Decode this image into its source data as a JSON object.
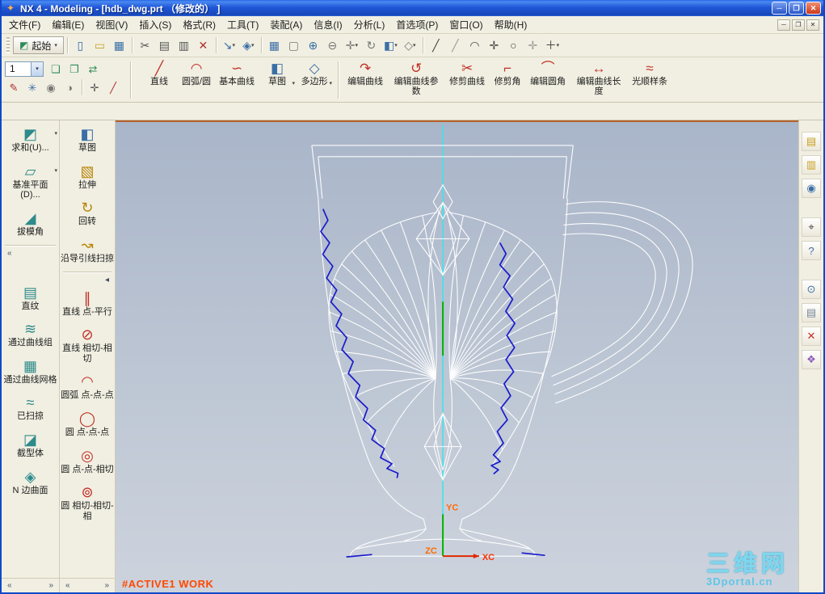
{
  "window": {
    "title": "NX 4 - Modeling - [hdb_dwg.prt （修改的） ]",
    "app_icon_glyph": "✦",
    "controls": {
      "minimize": "─",
      "maximize": "❐",
      "close": "✕"
    }
  },
  "menu": {
    "items": [
      "文件(F)",
      "编辑(E)",
      "视图(V)",
      "插入(S)",
      "格式(R)",
      "工具(T)",
      "装配(A)",
      "信息(I)",
      "分析(L)",
      "首选项(P)",
      "窗口(O)",
      "帮助(H)"
    ],
    "mdi_controls": [
      "─",
      "❐",
      "✕"
    ]
  },
  "toolbar_main": {
    "start_label": "起始",
    "start_icon_glyph": "◩",
    "icons": [
      {
        "name": "new-file-icon",
        "glyph": "▯",
        "color": "#3a6ea5"
      },
      {
        "name": "open-file-icon",
        "glyph": "▭",
        "color": "#c8a020"
      },
      {
        "name": "save-icon",
        "glyph": "▦",
        "color": "#3a6ea5"
      },
      {
        "sep": true
      },
      {
        "name": "cut-icon",
        "glyph": "✂",
        "color": "#555555"
      },
      {
        "name": "copy-icon",
        "glyph": "▤",
        "color": "#555555"
      },
      {
        "name": "paste-icon",
        "glyph": "▥",
        "color": "#555555"
      },
      {
        "name": "delete-icon",
        "glyph": "✕",
        "color": "#b03030"
      },
      {
        "sep": true
      },
      {
        "name": "transform-icon",
        "glyph": "↘",
        "color": "#3a6ea5",
        "arrow": true
      },
      {
        "name": "orient-view-icon",
        "glyph": "◈",
        "color": "#3a6ea5",
        "arrow": true
      },
      {
        "sep": true
      },
      {
        "name": "grid-icon",
        "glyph": "▦",
        "color": "#3a6ea5"
      },
      {
        "name": "fit-view-icon",
        "glyph": "▢",
        "color": "#777777"
      },
      {
        "name": "zoom-in-icon",
        "glyph": "⊕",
        "color": "#3a6ea5"
      },
      {
        "name": "zoom-out-icon",
        "glyph": "⊖",
        "color": "#777777"
      },
      {
        "name": "pan-icon",
        "glyph": "✛",
        "color": "#777777",
        "arrow": true
      },
      {
        "name": "rotate-view-icon",
        "glyph": "↻",
        "color": "#777777"
      },
      {
        "name": "shaded-display-icon",
        "glyph": "◧",
        "color": "#3a6ea5",
        "arrow": true
      },
      {
        "name": "wireframe-display-icon",
        "glyph": "◇",
        "color": "#777777",
        "arrow": true
      },
      {
        "sep": true
      },
      {
        "name": "line-snap-icon",
        "glyph": "╱",
        "color": "#444444"
      },
      {
        "name": "angled-line-snap-icon",
        "glyph": "╱",
        "color": "#999999"
      },
      {
        "name": "arc-snap-icon",
        "glyph": "◠",
        "color": "#444444"
      },
      {
        "name": "cross-snap-icon",
        "glyph": "✛",
        "color": "#444444"
      },
      {
        "name": "circle-snap-icon",
        "glyph": "○",
        "color": "#444444"
      },
      {
        "name": "point-snap-icon",
        "glyph": "✛",
        "color": "#999999"
      },
      {
        "name": "more-snap-icon",
        "glyph": "＋",
        "color": "#444444",
        "arrow": true
      }
    ]
  },
  "toolbar_curve": {
    "layer_value": "1",
    "row1_icons": [
      {
        "name": "layer-settings-icon",
        "glyph": "❏",
        "color": "#2e8b57"
      },
      {
        "name": "layer-visible-icon",
        "glyph": "❐",
        "color": "#2e8b57"
      },
      {
        "name": "move-to-layer-icon",
        "glyph": "⇄",
        "color": "#2e8b57"
      }
    ],
    "row2_icons": [
      {
        "name": "snap-endpoint-icon",
        "glyph": "✎",
        "color": "#b03030"
      },
      {
        "name": "snap-intersection-icon",
        "glyph": "✳",
        "color": "#3a6ea5"
      },
      {
        "name": "snap-center-icon",
        "glyph": "◉",
        "color": "#777777"
      },
      {
        "name": "snap-quadrant-icon",
        "glyph": "◑",
        "color": "#777777"
      },
      {
        "sep": true
      },
      {
        "name": "snap-existing-point-icon",
        "glyph": "✛",
        "color": "#555555"
      },
      {
        "name": "snap-midpoint-icon",
        "glyph": "╱",
        "color": "#b03030"
      }
    ],
    "groups": [
      {
        "buttons": [
          {
            "name": "line-button",
            "label": "直线",
            "glyph": "╱",
            "color": "#c03028"
          },
          {
            "name": "arc-circle-button",
            "label": "圆弧/圆",
            "glyph": "◠",
            "color": "#c03028"
          },
          {
            "name": "basic-curve-button",
            "label": "基本曲线",
            "glyph": "∽",
            "color": "#c03028"
          },
          {
            "name": "sketch-button",
            "label": "草图",
            "glyph": "◧",
            "color": "#3a6ea5",
            "arrow": true
          },
          {
            "name": "polygon-button",
            "label": "多边形",
            "glyph": "◇",
            "color": "#3a6ea5",
            "arrow": true
          }
        ]
      },
      {
        "buttons": [
          {
            "name": "edit-curve-button",
            "label": "编辑曲线",
            "glyph": "↷",
            "color": "#c03028"
          },
          {
            "name": "edit-curve-params-button",
            "label": "编辑曲线参数",
            "glyph": "↺",
            "color": "#c03028"
          },
          {
            "name": "trim-curve-button",
            "label": "修剪曲线",
            "glyph": "✂",
            "color": "#c03028"
          },
          {
            "name": "trim-corner-button",
            "label": "修剪角",
            "glyph": "⌐",
            "color": "#c03028"
          },
          {
            "name": "edit-fillet-button",
            "label": "编辑圆角",
            "glyph": "⌒",
            "color": "#c03028"
          },
          {
            "name": "edit-curve-length-button",
            "label": "编辑曲线长度",
            "glyph": "↔",
            "color": "#c03028"
          },
          {
            "name": "smooth-spline-button",
            "label": "光顺样条",
            "glyph": "≈",
            "color": "#c03028"
          }
        ]
      }
    ]
  },
  "left_panel": {
    "col1_groups": [
      [
        {
          "name": "boolean-sum-button",
          "label": "求和(U)...",
          "glyph": "◩",
          "color": "#2e8b8b",
          "arrow": true
        },
        {
          "name": "datum-plane-button",
          "label": "基准平面(D)...",
          "glyph": "▱",
          "color": "#2e8b8b",
          "arrow": true
        },
        {
          "name": "draft-angle-button",
          "label": "拔模角",
          "glyph": "◢",
          "color": "#2e8b8b"
        }
      ],
      [
        {
          "name": "ruled-surface-button",
          "label": "直纹",
          "glyph": "▤",
          "color": "#2e8b8b"
        },
        {
          "name": "through-curves-button",
          "label": "通过曲线组",
          "glyph": "≋",
          "color": "#2e8b8b"
        },
        {
          "name": "through-curve-mesh-button",
          "label": "通过曲线网格",
          "glyph": "▦",
          "color": "#2e8b8b"
        },
        {
          "name": "swept-button",
          "label": "已扫掠",
          "glyph": "≈",
          "color": "#2e8b8b"
        },
        {
          "name": "section-body-button",
          "label": "截型体",
          "glyph": "◪",
          "color": "#2e8b8b"
        },
        {
          "name": "n-sided-surface-button",
          "label": "N 边曲面",
          "glyph": "◈",
          "color": "#2e8b8b"
        }
      ]
    ],
    "col2_groups": [
      [
        {
          "name": "sketch-feature-button",
          "label": "草图",
          "glyph": "◧",
          "color": "#3a6ea5"
        },
        {
          "name": "extrude-button",
          "label": "拉伸",
          "glyph": "▧",
          "color": "#b8860b"
        },
        {
          "name": "revolve-button",
          "label": "回转",
          "glyph": "↻",
          "color": "#b8860b"
        },
        {
          "name": "sweep-along-guide-button",
          "label": "沿导引线扫掠",
          "glyph": "↝",
          "color": "#b8860b"
        }
      ],
      [
        {
          "name": "line-point-parallel-button",
          "label": "直线 点-平行",
          "glyph": "∥",
          "color": "#c03028"
        },
        {
          "name": "line-tangent-tangent-button",
          "label": "直线 相切-相切",
          "glyph": "⊘",
          "color": "#c03028"
        },
        {
          "name": "arc-point-point-point-button",
          "label": "圆弧 点-点-点",
          "glyph": "◠",
          "color": "#c03028"
        },
        {
          "name": "circle-point-point-point-button",
          "label": "圆 点-点-点",
          "glyph": "◯",
          "color": "#c03028"
        },
        {
          "name": "circle-point-point-tangent-button",
          "label": "圆 点-点-相切",
          "glyph": "◎",
          "color": "#c03028"
        },
        {
          "name": "circle-tangent-tangent-button",
          "label": "圆 相切-相切-相",
          "glyph": "⊚",
          "color": "#c03028"
        }
      ]
    ],
    "scroll_left_glyph": "«",
    "scroll_right_glyph": "»",
    "col1_collapse_glyph": "«",
    "col2_collapse_glyph": "◂"
  },
  "right_panel": {
    "groups": [
      [
        {
          "name": "part-navigator-icon",
          "glyph": "▤",
          "color": "#c8a020"
        },
        {
          "name": "assembly-navigator-icon",
          "glyph": "▥",
          "color": "#c8a020"
        },
        {
          "name": "web-browser-icon",
          "glyph": "◉",
          "color": "#3a6ea5"
        }
      ],
      [
        {
          "name": "search-icon",
          "glyph": "⌖",
          "color": "#444444"
        },
        {
          "name": "help-icon",
          "glyph": "?",
          "color": "#3a6ea5"
        }
      ],
      [
        {
          "name": "history-icon",
          "glyph": "⊙",
          "color": "#3a6ea5"
        },
        {
          "name": "information-palette-icon",
          "glyph": "▤",
          "color": "#778899"
        },
        {
          "name": "tools-palette-icon",
          "glyph": "✕",
          "color": "#c03028"
        },
        {
          "name": "roles-palette-icon",
          "glyph": "❖",
          "color": "#8b5cb8"
        }
      ]
    ]
  },
  "canvas": {
    "status_text": "#ACTIVE1 WORK",
    "axis": {
      "y_label": "YC",
      "x_label": "XC",
      "z_label": "ZC"
    },
    "watermark": {
      "line1": "三维网",
      "line2": "3Dportal.cn"
    },
    "colors": {
      "background_top": "#a9b5c9",
      "background_bottom": "#cdd3dd",
      "wireframe": "#fdfdfd",
      "zigzag": "#1a1acb",
      "centerline": "#41e2ea",
      "axis_x": "#e02800",
      "axis_y": "#00b400",
      "axis_label": "#ff6a00",
      "status": "#ff4800",
      "watermark": "#5ec6e6"
    }
  }
}
